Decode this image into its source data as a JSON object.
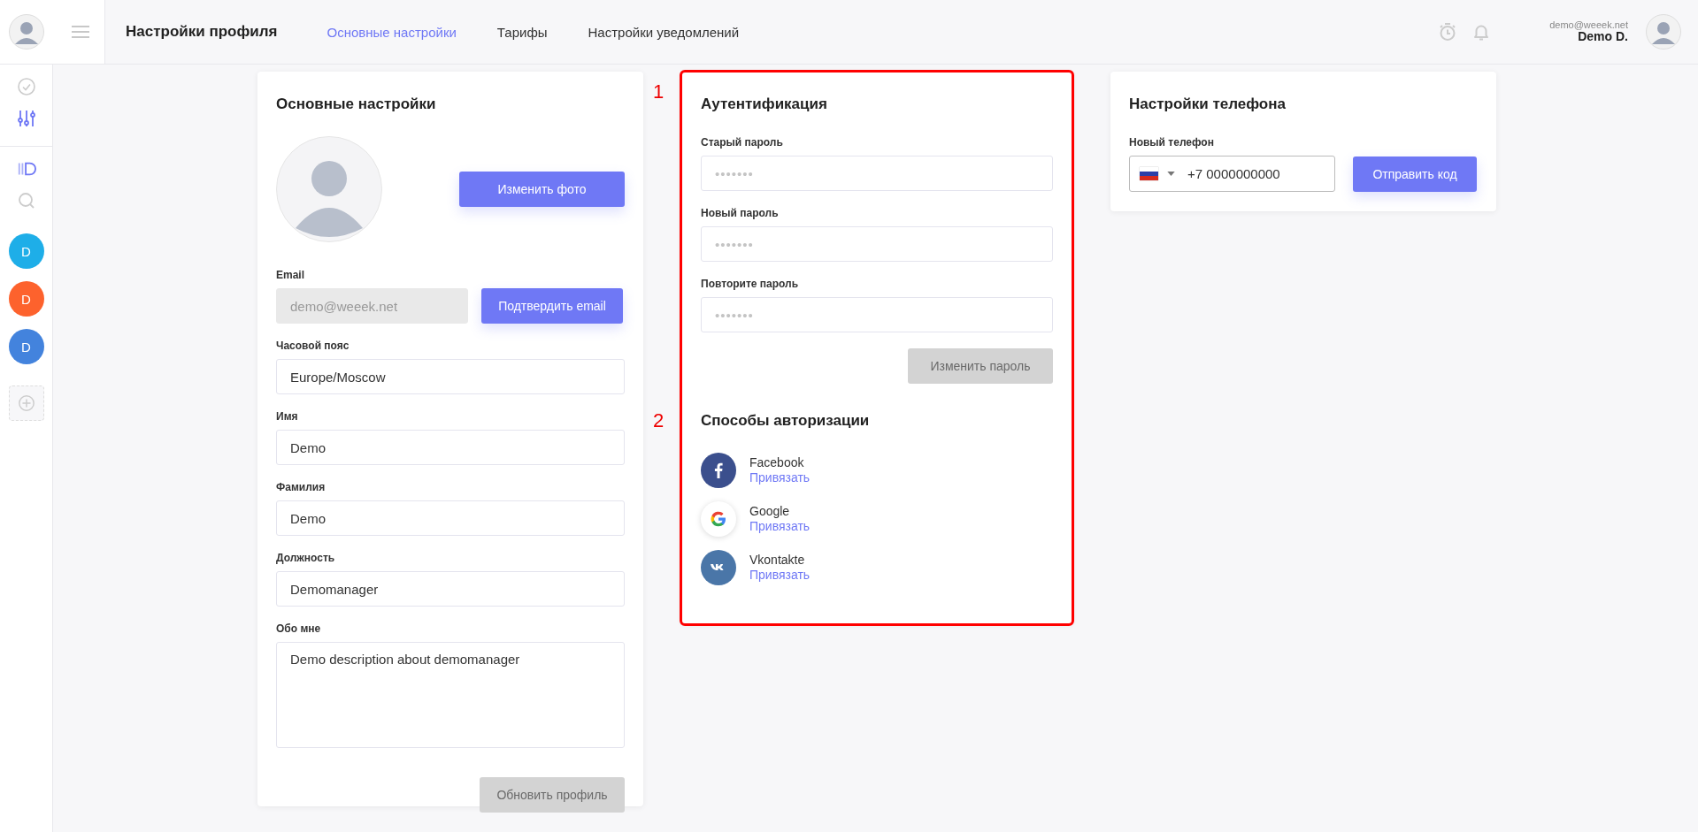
{
  "topbar": {
    "title": "Настройки профиля",
    "tabs": [
      {
        "label": "Основные настройки",
        "selected": true
      },
      {
        "label": "Тарифы",
        "selected": false
      },
      {
        "label": "Настройки уведомлений",
        "selected": false
      }
    ],
    "user": {
      "email": "demo@weeek.net",
      "name": "Demo D."
    }
  },
  "sidebar": {
    "top": [
      {
        "kind": "check",
        "selected": false
      },
      {
        "kind": "sliders",
        "selected": true
      }
    ],
    "items": [
      {
        "kind": "board"
      },
      {
        "kind": "search"
      },
      {
        "kind": "avatar",
        "label": "D",
        "color": "#1eaee8"
      },
      {
        "kind": "avatar",
        "label": "D",
        "color": "#fd622d"
      },
      {
        "kind": "avatar",
        "label": "D",
        "color": "#4383dd"
      },
      {
        "kind": "add"
      }
    ]
  },
  "main_card": {
    "title": "Основные настройки",
    "change_photo_button": "Изменить фото",
    "email": {
      "label": "Email",
      "value": "demo@weeek.net",
      "disabled": true,
      "button": "Подтвердить email"
    },
    "fields": [
      {
        "label": "Часовой пояс",
        "value": "Europe/Moscow",
        "kind": "input"
      },
      {
        "label": "Имя",
        "value": "Demo",
        "kind": "input"
      },
      {
        "label": "Фамилия",
        "value": "Demo",
        "kind": "input"
      },
      {
        "label": "Должность",
        "value": "Demomanager",
        "kind": "input"
      },
      {
        "label": "Обо мне",
        "value": "Demo description about demomanager",
        "kind": "textarea"
      }
    ],
    "submit": {
      "label": "Обновить профиль",
      "disabled": true
    }
  },
  "auth_card": {
    "highlighted": true,
    "marker": "1",
    "title": "Аутентификация",
    "fields": [
      {
        "label": "Старый пароль",
        "placeholder": "•••••••"
      },
      {
        "label": "Новый пароль",
        "placeholder": "•••••••"
      },
      {
        "label": "Повторите пароль",
        "placeholder": "•••••••"
      }
    ],
    "submit": {
      "label": "Изменить пароль",
      "disabled": true
    },
    "methods": {
      "marker": "2",
      "title": "Способы авторизации",
      "items": [
        {
          "kind": "facebook",
          "name": "Facebook",
          "link": "Привязать"
        },
        {
          "kind": "google",
          "name": "Google",
          "link": "Привязать"
        },
        {
          "kind": "vkontakte",
          "name": "Vkontakte",
          "link": "Привязать"
        }
      ]
    }
  },
  "phone_card": {
    "title": "Настройки телефона",
    "label": "Новый телефон",
    "value": "+7 0000000000",
    "button": "Отправить код"
  }
}
